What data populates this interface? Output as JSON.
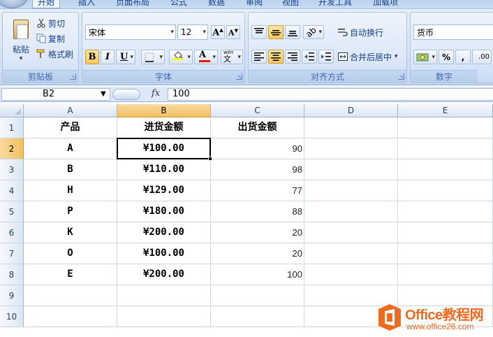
{
  "tabs": [
    {
      "label": "开始",
      "active": true
    },
    {
      "label": "插入",
      "active": false
    },
    {
      "label": "页面布局",
      "active": false
    },
    {
      "label": "公式",
      "active": false
    },
    {
      "label": "数据",
      "active": false
    },
    {
      "label": "审阅",
      "active": false
    },
    {
      "label": "视图",
      "active": false
    },
    {
      "label": "开发工具",
      "active": false
    },
    {
      "label": "加载项",
      "active": false
    }
  ],
  "ribbon": {
    "clipboard": {
      "label": "剪贴板",
      "paste": "粘贴",
      "cut": "剪切",
      "copy": "复制",
      "format_painter": "格式刷"
    },
    "font": {
      "label": "字体",
      "font_name": "宋体",
      "font_size": "12",
      "bold": "B",
      "italic": "I",
      "underline": "U",
      "font_color_glyph": "A",
      "phonetic_glyph": "文",
      "phonetic_top": "wén",
      "highlight_color": "#ffff00",
      "font_color": "#ff0000"
    },
    "alignment": {
      "label": "对齐方式",
      "wrap_text": "自动换行",
      "merge_center": "合并后居中"
    },
    "number": {
      "label": "数字",
      "format": "货币",
      "percent": "%",
      "comma": ",",
      "increase_decimal": ".00"
    }
  },
  "formula_bar": {
    "name_box": "B2",
    "fx": "fx",
    "value": "100"
  },
  "grid": {
    "columns": [
      "A",
      "B",
      "C",
      "D",
      "E"
    ],
    "selected_column": "B",
    "rows": [
      "1",
      "2",
      "3",
      "4",
      "5",
      "6",
      "7",
      "8",
      "9",
      "10"
    ],
    "selected_row": "2",
    "cells": [
      [
        "产品",
        "进货金额",
        "出货金额",
        "",
        ""
      ],
      [
        "A",
        "¥100.00",
        "90",
        "",
        ""
      ],
      [
        "B",
        "¥110.00",
        "98",
        "",
        ""
      ],
      [
        "H",
        "¥129.00",
        "77",
        "",
        ""
      ],
      [
        "P",
        "¥180.00",
        "88",
        "",
        ""
      ],
      [
        "K",
        "¥200.00",
        "20",
        "",
        ""
      ],
      [
        "O",
        "¥100.00",
        "20",
        "",
        ""
      ],
      [
        "E",
        "¥200.00",
        "100",
        "",
        ""
      ],
      [
        "",
        "",
        "",
        "",
        ""
      ],
      [
        "",
        "",
        "",
        "",
        ""
      ]
    ]
  },
  "watermark": {
    "title": "Office教程网",
    "url": "www.office26.com",
    "brand_color": "#ef6b1f"
  }
}
